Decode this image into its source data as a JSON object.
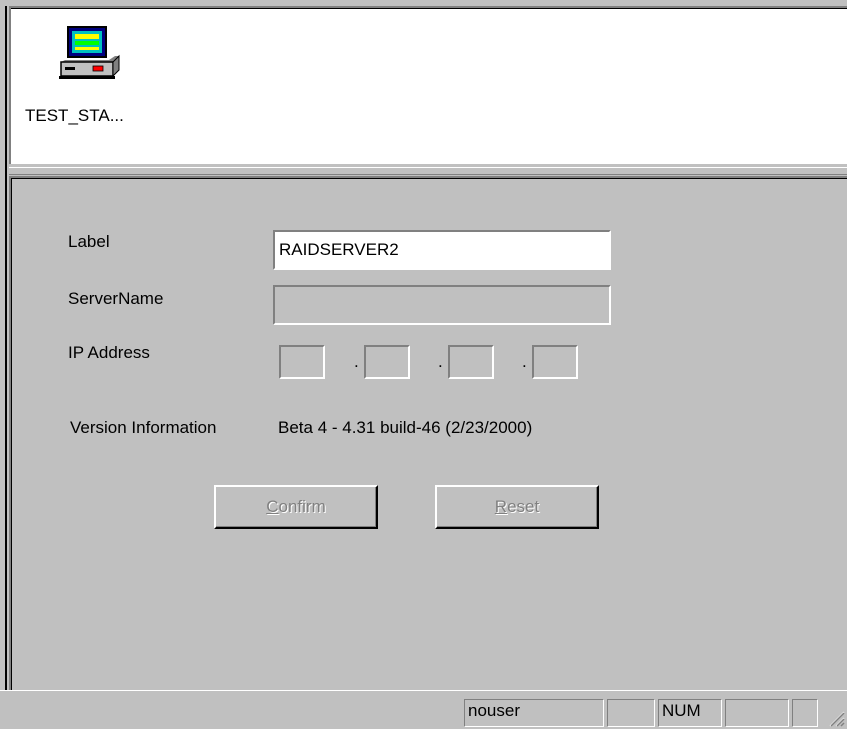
{
  "station": {
    "label": "TEST_STA...",
    "icon": "server-station-icon"
  },
  "form": {
    "label_caption": "Label",
    "label_value": "RAIDSERVER2",
    "servername_caption": "ServerName",
    "servername_value": "",
    "ip_caption": "IP Address",
    "ip_separator": ".",
    "version_caption": "Version Information",
    "version_value": "Beta 4 - 4.31 build-46 (2/23/2000)"
  },
  "buttons": {
    "confirm_mnemonic": "C",
    "confirm_rest": "onfirm",
    "reset_mnemonic": "R",
    "reset_rest": "eset"
  },
  "status_bar": {
    "user": "nouser",
    "num": "NUM"
  }
}
